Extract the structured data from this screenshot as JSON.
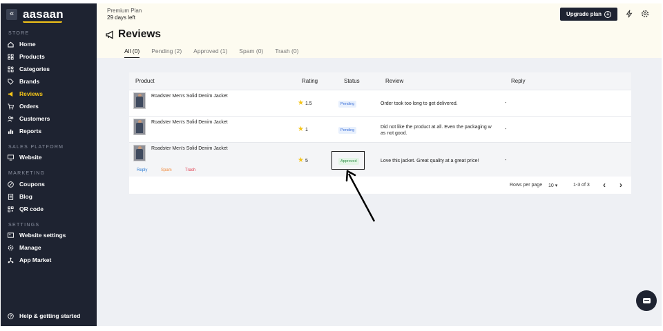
{
  "sidebar": {
    "brand": "aasaan",
    "collapse_icon": "double-chevron-left-icon",
    "sections": {
      "store": "STORE",
      "sales_platform": "SALES PLATFORM",
      "marketing": "MARKETING",
      "settings": "SETTINGS"
    },
    "items": {
      "home": "Home",
      "products": "Products",
      "categories": "Categories",
      "brands": "Brands",
      "reviews": "Reviews",
      "orders": "Orders",
      "customers": "Customers",
      "reports": "Reports",
      "website": "Website",
      "coupons": "Coupons",
      "blog": "Blog",
      "qr_code": "QR code",
      "website_settings": "Website settings",
      "manage": "Manage",
      "app_market": "App Market",
      "help": "Help & getting started"
    },
    "active_item": "Reviews",
    "active_color": "#f5c518",
    "background": "#1e2331"
  },
  "topbar": {
    "plan_name": "Premium Plan",
    "plan_days": "29 days left",
    "upgrade_label": "Upgrade plan",
    "upgrade_icon": "plus-circle-icon",
    "icons": [
      "lightning-icon",
      "gear-icon"
    ]
  },
  "page": {
    "title": "Reviews",
    "title_icon": "megaphone-icon",
    "tabs": [
      "All (0)",
      "Pending (2)",
      "Approved (1)",
      "Spam (0)",
      "Trash (0)"
    ],
    "active_tab": "All (0)"
  },
  "table": {
    "headers": {
      "product": "Product",
      "rating": "Rating",
      "status": "Status",
      "review": "Review",
      "reply": "Reply"
    },
    "rows": [
      {
        "product": "Roadster Men's Solid Denim Jacket",
        "rating": "1.5",
        "status": "Pending",
        "review": "Order took too long to get delivered.",
        "review_line2": "",
        "reply": "-"
      },
      {
        "product": "Roadster Men's Solid Denim Jacket",
        "rating": "1",
        "status": "Pending",
        "review": "Did not like the product at all. Even the packaging w",
        "review_line2": "as not good.",
        "reply": "-"
      },
      {
        "product": "Roadster Men's Solid Denim Jacket",
        "rating": "5",
        "status": "Approved",
        "review": "Love this jacket. Great quality at a great price!",
        "review_line2": "",
        "reply": "-",
        "actions": {
          "reply": "Reply",
          "spam": "Spam",
          "trash": "Trash"
        }
      }
    ]
  },
  "pagination": {
    "rows_per_page_label": "Rows per page",
    "rows_per_page_value": "10",
    "range": "1-3 of 3",
    "prev_icon": "chevron-left-icon",
    "next_icon": "chevron-right-icon"
  },
  "chat": {
    "icon": "chat-bubble-icon"
  }
}
